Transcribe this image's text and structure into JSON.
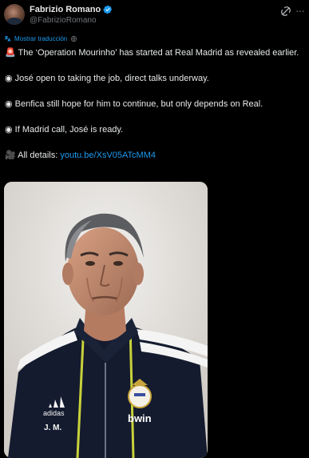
{
  "author": {
    "name": "Fabrizio Romano",
    "handle": "@FabrizioRomano",
    "verified_color": "#1d9bf0"
  },
  "translate": {
    "label": "Mostrar traducción"
  },
  "tweet": {
    "line1": "🚨 The ‘Operation Mourinho’ has started at Real Madrid as revealed earlier.",
    "line2": "◉ José open to taking the job, direct talks underway.",
    "line3": "◉ Benfica still hope for him to continue, but only depends on Real.",
    "line4": "◉ If Madrid call, José is ready.",
    "line5_prefix": "🎥 All details: ",
    "link": "youtu.be/XsV05ATcMM4"
  },
  "media": {
    "jacket_text": "adidas",
    "initials": "J. M.",
    "sponsor": "bwin"
  },
  "icons": {
    "grok": "grok-icon",
    "more": "more-icon",
    "verified": "verified-badge-icon",
    "translate": "translate-icon",
    "globe": "globe-icon"
  }
}
